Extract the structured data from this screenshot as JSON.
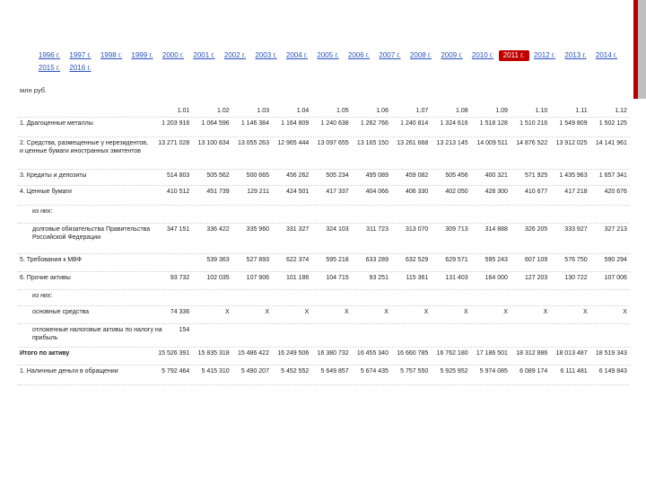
{
  "years_row1": [
    "1996 г.",
    "1997 г.",
    "1998 г.",
    "1999 г.",
    "2000 г.",
    "2001 г.",
    "2002 г.",
    "2003 г.",
    "2004 г.",
    "2005 г.",
    "2006 г.",
    "2007 г.",
    "2008 г.",
    "2009 г.",
    "2010 г.",
    "2011 г.",
    "2012 г.",
    "2013 г.",
    "2014 г."
  ],
  "years_row2": [
    "2015 г.",
    "2016 г."
  ],
  "active_year": "2011 г.",
  "unit": "млн руб.",
  "dates": [
    "1.01",
    "1.02",
    "1.03",
    "1.04",
    "1.05",
    "1.06",
    "1.07",
    "1.08",
    "1.09",
    "1.10",
    "1.11",
    "1.12"
  ],
  "rows": [
    {
      "label": "1. Драгоценные металлы",
      "values": [
        "1 203 916",
        "1 064 596",
        "1 146 384",
        "1 164 809",
        "1 240 638",
        "1 262 766",
        "1 240 814",
        "1 324 616",
        "1 518 128",
        "1 510 216",
        "1 549 809",
        "1 502 125"
      ]
    },
    {
      "label": "2. Средства, размещенные у нерезидентов, и ценные бумаги иностранных эмитентов",
      "values": [
        "13 271 028",
        "13 100 834",
        "13 055 263",
        "12 965 444",
        "13 097 655",
        "13 165 150",
        "13 261 668",
        "13 213 145",
        "14 009 511",
        "14 876 522",
        "13 912 025",
        "14 141 961"
      ]
    },
    {
      "label": "3. Кредиты и депозиты",
      "values": [
        "514 803",
        "505 562",
        "500 665",
        "456 262",
        "505 234",
        "495 089",
        "459 082",
        "505 456",
        "400 321",
        "571 925",
        "1 435 963",
        "1 657 341"
      ]
    },
    {
      "label": "4. Ценные бумаги",
      "values": [
        "410 512",
        "451 739",
        "129 211",
        "424 501",
        "417 337",
        "404 066",
        "406 330",
        "402 050",
        "428 300",
        "410 677",
        "417 218",
        "420 676"
      ]
    },
    {
      "label": "из них:",
      "values": [],
      "indent": true
    },
    {
      "label": "долговые обязательства Правительства Российской Федерации",
      "values": [
        "347 151",
        "336 422",
        "335 960",
        "331 327",
        "324 103",
        "311 723",
        "313 070",
        "309 713",
        "314 888",
        "326 205",
        "333 927",
        "327 213"
      ],
      "indent": true
    },
    {
      "label": "5. Требования к МВФ",
      "values": [
        "",
        "539 363",
        "527 893",
        "622 374",
        "595 218",
        "633 289",
        "632 529",
        "629 571",
        "595 243",
        "607 109",
        "576 750",
        "590 294"
      ]
    },
    {
      "label": "6. Прочие активы",
      "values": [
        "93 732",
        "102 035",
        "107 906",
        "101 186",
        "104 715",
        "93 251",
        "115 361",
        "131 403",
        "164 000",
        "127 203",
        "130 722",
        "107 006"
      ]
    },
    {
      "label": "из них:",
      "values": [],
      "indent": true
    },
    {
      "label": "основные средства",
      "values": [
        "74 336",
        "X",
        "X",
        "X",
        "X",
        "X",
        "X",
        "X",
        "X",
        "X",
        "X",
        "X"
      ],
      "indent": true
    },
    {
      "label": "отложенные налоговые активы по налогу на прибыль",
      "values": [
        "154",
        "",
        "",
        "",
        "",
        "",
        "",
        "",
        "",
        "",
        "",
        ""
      ],
      "indent": true
    },
    {
      "label": "Итого по активу",
      "values": [
        "15 526 391",
        "15 835 318",
        "15 486 422",
        "16 249 506",
        "16 380 732",
        "16 455 340",
        "16 660 785",
        "16 762 180",
        "17 186 501",
        "18 312 886",
        "18 013 487",
        "18 519 343"
      ],
      "bold": true
    },
    {
      "label": "1. Наличные деньги в обращении",
      "values": [
        "5 792 464",
        "5 415 310",
        "5 490 207",
        "5 452 552",
        "5 649 857",
        "5 674 435",
        "5 757 550",
        "5 925 952",
        "5 974 085",
        "6 089 174",
        "6 111 481",
        "6 149 843"
      ]
    }
  ]
}
